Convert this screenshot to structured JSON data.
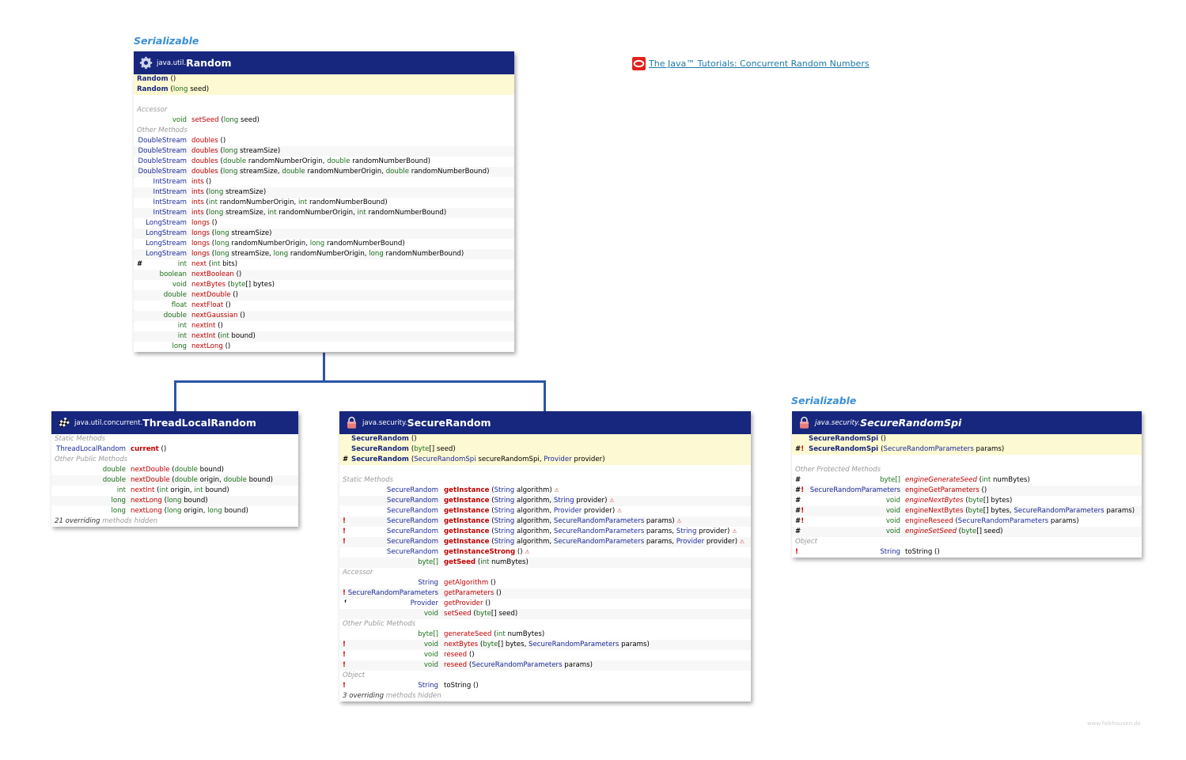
{
  "interfaces": {
    "random": "Serializable",
    "securerandomspi": "Serializable"
  },
  "link": {
    "text": "The Java™ Tutorials: Concurrent Random Numbers"
  },
  "credit": "www.falkhausen.de",
  "random": {
    "pkg": "java.util.",
    "name": "Random",
    "ctors": [
      {
        "name": "Random",
        "args": "()"
      },
      {
        "name": "Random",
        "args": "(long seed)"
      }
    ],
    "sections": {
      "accessor": "Accessor",
      "other": "Other Methods"
    },
    "accessor": [
      {
        "mk": "",
        "ret": "void",
        "name": "setSeed",
        "args": "(long seed)"
      }
    ],
    "methods": [
      {
        "mk": "",
        "ret": "DoubleStream",
        "name": "doubles",
        "args": "()"
      },
      {
        "mk": "",
        "ret": "DoubleStream",
        "name": "doubles",
        "args": "(long streamSize)"
      },
      {
        "mk": "",
        "ret": "DoubleStream",
        "name": "doubles",
        "args": "(double randomNumberOrigin, double randomNumberBound)"
      },
      {
        "mk": "",
        "ret": "DoubleStream",
        "name": "doubles",
        "args": "(long streamSize, double randomNumberOrigin, double randomNumberBound)"
      },
      {
        "mk": "",
        "ret": "IntStream",
        "name": "ints",
        "args": "()"
      },
      {
        "mk": "",
        "ret": "IntStream",
        "name": "ints",
        "args": "(long streamSize)"
      },
      {
        "mk": "",
        "ret": "IntStream",
        "name": "ints",
        "args": "(int randomNumberOrigin, int randomNumberBound)"
      },
      {
        "mk": "",
        "ret": "IntStream",
        "name": "ints",
        "args": "(long streamSize, int randomNumberOrigin, int randomNumberBound)"
      },
      {
        "mk": "",
        "ret": "LongStream",
        "name": "longs",
        "args": "()"
      },
      {
        "mk": "",
        "ret": "LongStream",
        "name": "longs",
        "args": "(long streamSize)"
      },
      {
        "mk": "",
        "ret": "LongStream",
        "name": "longs",
        "args": "(long randomNumberOrigin, long randomNumberBound)"
      },
      {
        "mk": "",
        "ret": "LongStream",
        "name": "longs",
        "args": "(long streamSize, long randomNumberOrigin, long randomNumberBound)"
      },
      {
        "mk": "#",
        "ret": "int",
        "name": "next",
        "args": "(int bits)"
      },
      {
        "mk": "",
        "ret": "boolean",
        "name": "nextBoolean",
        "args": "()"
      },
      {
        "mk": "",
        "ret": "void",
        "name": "nextBytes",
        "args": "(byte[] bytes)"
      },
      {
        "mk": "",
        "ret": "double",
        "name": "nextDouble",
        "args": "()"
      },
      {
        "mk": "",
        "ret": "float",
        "name": "nextFloat",
        "args": "()"
      },
      {
        "mk": "",
        "ret": "double",
        "name": "nextGaussian",
        "args": "()"
      },
      {
        "mk": "",
        "ret": "int",
        "name": "nextInt",
        "args": "()"
      },
      {
        "mk": "",
        "ret": "int",
        "name": "nextInt",
        "args": "(int bound)"
      },
      {
        "mk": "",
        "ret": "long",
        "name": "nextLong",
        "args": "()"
      }
    ]
  },
  "tlr": {
    "pkg": "java.util.concurrent.",
    "name": "ThreadLocalRandom",
    "sections": {
      "static": "Static Methods",
      "other": "Other Public Methods"
    },
    "static": [
      {
        "mk": "",
        "ret": "ThreadLocalRandom",
        "name": "current",
        "args": "()",
        "bold": true
      }
    ],
    "methods": [
      {
        "mk": "",
        "ret": "double",
        "name": "nextDouble",
        "args": "(double bound)"
      },
      {
        "mk": "",
        "ret": "double",
        "name": "nextDouble",
        "args": "(double origin, double bound)"
      },
      {
        "mk": "",
        "ret": "int",
        "name": "nextInt",
        "args": "(int origin, int bound)"
      },
      {
        "mk": "",
        "ret": "long",
        "name": "nextLong",
        "args": "(long bound)"
      },
      {
        "mk": "",
        "ret": "long",
        "name": "nextLong",
        "args": "(long origin, long bound)"
      }
    ],
    "footer": {
      "count": "21 overriding",
      "rest": "methods hidden"
    }
  },
  "sr": {
    "pkg": "java.security.",
    "name": "SecureRandom",
    "ctors": [
      {
        "mk": "",
        "name": "SecureRandom",
        "args": "()"
      },
      {
        "mk": "",
        "name": "SecureRandom",
        "args": "(byte[] seed)"
      },
      {
        "mk": "#",
        "name": "SecureRandom",
        "args": "(SecureRandomSpi secureRandomSpi, Provider provider)"
      }
    ],
    "sections": {
      "static": "Static Methods",
      "accessor": "Accessor",
      "other": "Other Public Methods",
      "object": "Object"
    },
    "static": [
      {
        "mk": "",
        "ret": "SecureRandom",
        "name": "getInstance",
        "args": "(String algorithm)",
        "bold": true,
        "hl": "⚠"
      },
      {
        "mk": "",
        "ret": "SecureRandom",
        "name": "getInstance",
        "args": "(String algorithm, String provider)",
        "bold": true,
        "hl": "⚠"
      },
      {
        "mk": "",
        "ret": "SecureRandom",
        "name": "getInstance",
        "args": "(String algorithm, Provider provider)",
        "bold": true,
        "hl": "⚠"
      },
      {
        "mk": "!",
        "ret": "SecureRandom",
        "name": "getInstance",
        "args": "(String algorithm, SecureRandomParameters params)",
        "bold": true,
        "hl": "⚠"
      },
      {
        "mk": "!",
        "ret": "SecureRandom",
        "name": "getInstance",
        "args": "(String algorithm, SecureRandomParameters params, String provider)",
        "bold": true,
        "hl": "⚠"
      },
      {
        "mk": "!",
        "ret": "SecureRandom",
        "name": "getInstance",
        "args": "(String algorithm, SecureRandomParameters params, Provider provider)",
        "bold": true,
        "hl": "⚠"
      },
      {
        "mk": "",
        "ret": "SecureRandom",
        "name": "getInstanceStrong",
        "args": "()",
        "bold": true,
        "hl": "⚠"
      },
      {
        "mk": "",
        "ret": "byte[]",
        "name": "getSeed",
        "args": "(int numBytes)",
        "bold": true
      }
    ],
    "accessor": [
      {
        "mk": "",
        "ret": "String",
        "name": "getAlgorithm",
        "args": "()"
      },
      {
        "mk": "!",
        "ret": "SecureRandomParameters",
        "name": "getParameters",
        "args": "()"
      },
      {
        "mk": "ᶠ",
        "ret": "Provider",
        "name": "getProvider",
        "args": "()"
      },
      {
        "mk": "",
        "ret": "void",
        "name": "setSeed",
        "args": "(byte[] seed)"
      }
    ],
    "methods": [
      {
        "mk": "",
        "ret": "byte[]",
        "name": "generateSeed",
        "args": "(int numBytes)"
      },
      {
        "mk": "!",
        "ret": "void",
        "name": "nextBytes",
        "args": "(byte[] bytes, SecureRandomParameters params)"
      },
      {
        "mk": "!",
        "ret": "void",
        "name": "reseed",
        "args": "()"
      },
      {
        "mk": "!",
        "ret": "void",
        "name": "reseed",
        "args": "(SecureRandomParameters params)"
      }
    ],
    "object": [
      {
        "mk": "!",
        "ret": "String",
        "name": "toString",
        "args": "()",
        "black": true
      }
    ],
    "footer": {
      "count": "3 overriding",
      "rest": "methods hidden"
    }
  },
  "spi": {
    "pkg": "java.security.",
    "name": "SecureRandomSpi",
    "ctors": [
      {
        "mk": "",
        "name": "SecureRandomSpi",
        "args": "()"
      },
      {
        "mk": "#!",
        "name": "SecureRandomSpi",
        "args": "(SecureRandomParameters params)"
      }
    ],
    "sections": {
      "protected": "Other Protected Methods",
      "object": "Object"
    },
    "methods": [
      {
        "mk": "#",
        "ret": "byte[]",
        "name": "engineGenerateSeed",
        "args": "(int numBytes)",
        "italic": true
      },
      {
        "mk": "#!",
        "ret": "SecureRandomParameters",
        "name": "engineGetParameters",
        "args": "()"
      },
      {
        "mk": "#",
        "ret": "void",
        "name": "engineNextBytes",
        "args": "(byte[] bytes)",
        "italic": true
      },
      {
        "mk": "#!",
        "ret": "void",
        "name": "engineNextBytes",
        "args": "(byte[] bytes, SecureRandomParameters params)"
      },
      {
        "mk": "#!",
        "ret": "void",
        "name": "engineReseed",
        "args": "(SecureRandomParameters params)"
      },
      {
        "mk": "#",
        "ret": "void",
        "name": "engineSetSeed",
        "args": "(byte[] seed)",
        "italic": true
      }
    ],
    "object": [
      {
        "mk": "!",
        "ret": "String",
        "name": "toString",
        "args": "()",
        "black": true
      }
    ]
  }
}
